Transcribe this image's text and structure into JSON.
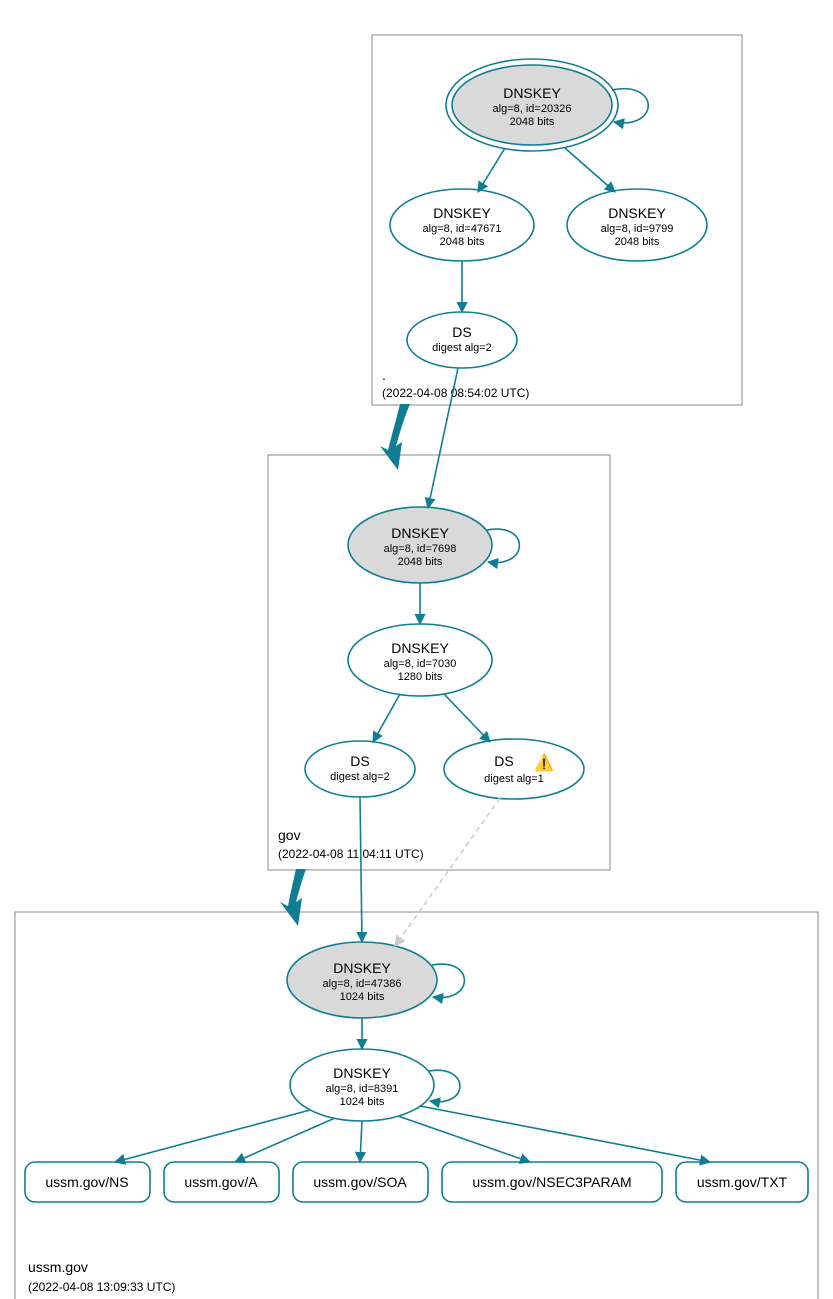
{
  "zones": {
    "root": {
      "label": ".",
      "timestamp": "(2022-04-08 08:54:02 UTC)"
    },
    "gov": {
      "label": "gov",
      "timestamp": "(2022-04-08 11:04:11 UTC)"
    },
    "ussm": {
      "label": "ussm.gov",
      "timestamp": "(2022-04-08 13:09:33 UTC)"
    }
  },
  "nodes": {
    "root_ksk": {
      "title": "DNSKEY",
      "line2": "alg=8, id=20326",
      "line3": "2048 bits"
    },
    "root_zsk1": {
      "title": "DNSKEY",
      "line2": "alg=8, id=47671",
      "line3": "2048 bits"
    },
    "root_zsk2": {
      "title": "DNSKEY",
      "line2": "alg=8, id=9799",
      "line3": "2048 bits"
    },
    "root_ds": {
      "title": "DS",
      "line2": "digest alg=2"
    },
    "gov_ksk": {
      "title": "DNSKEY",
      "line2": "alg=8, id=7698",
      "line3": "2048 bits"
    },
    "gov_zsk": {
      "title": "DNSKEY",
      "line2": "alg=8, id=7030",
      "line3": "1280 bits"
    },
    "gov_ds1": {
      "title": "DS",
      "line2": "digest alg=2"
    },
    "gov_ds2": {
      "title": "DS",
      "line2": "digest alg=1"
    },
    "ussm_ksk": {
      "title": "DNSKEY",
      "line2": "alg=8, id=47386",
      "line3": "1024 bits"
    },
    "ussm_zsk": {
      "title": "DNSKEY",
      "line2": "alg=8, id=8391",
      "line3": "1024 bits"
    },
    "rr_ns": {
      "title": "ussm.gov/NS"
    },
    "rr_a": {
      "title": "ussm.gov/A"
    },
    "rr_soa": {
      "title": "ussm.gov/SOA"
    },
    "rr_nsec3": {
      "title": "ussm.gov/NSEC3PARAM"
    },
    "rr_txt": {
      "title": "ussm.gov/TXT"
    }
  },
  "icons": {
    "warning": "⚠️"
  }
}
